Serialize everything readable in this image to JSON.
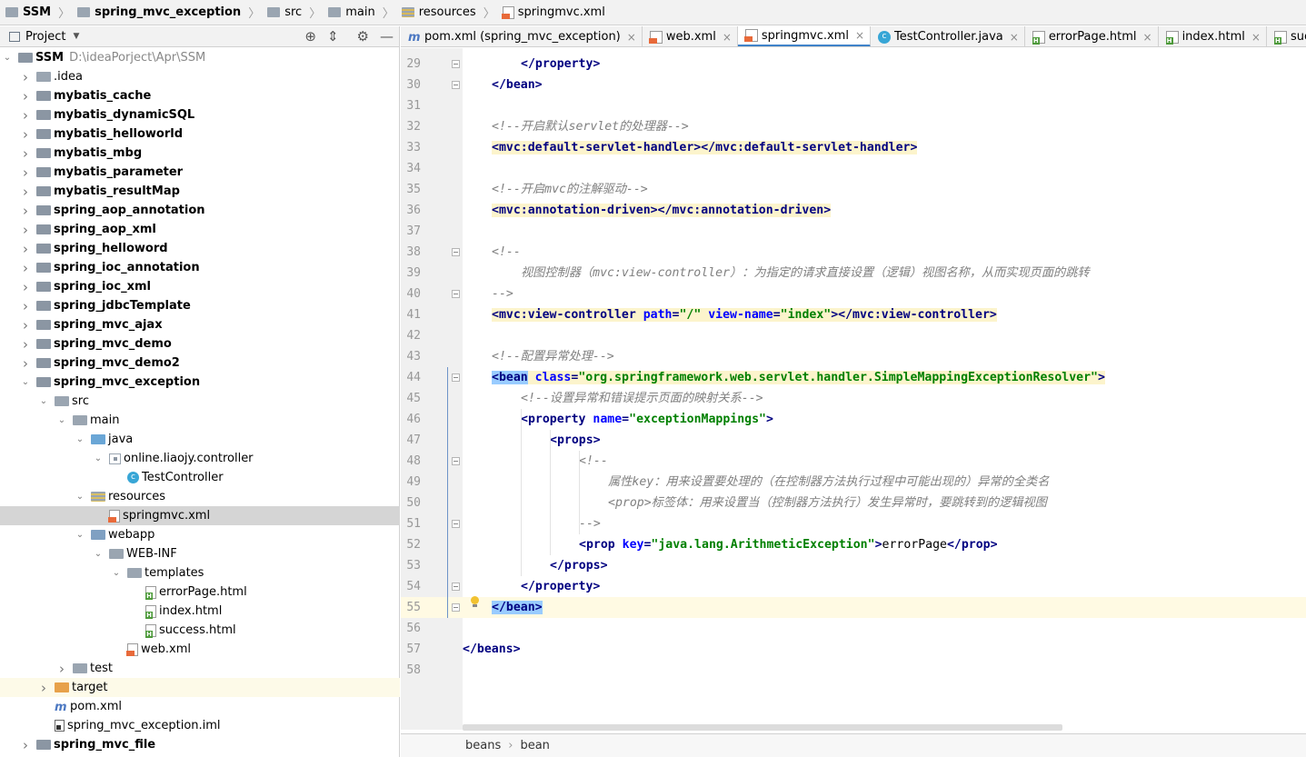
{
  "breadcrumb": [
    "SSM",
    "spring_mvc_exception",
    "src",
    "main",
    "resources",
    "springmvc.xml"
  ],
  "project_panel": {
    "title": "Project",
    "tools": [
      "target-icon",
      "collapse-icon",
      "gear-icon",
      "minimize-icon"
    ]
  },
  "tree": [
    {
      "label": "SSM",
      "extra": "D:\\ideaPorject\\Apr\\SSM",
      "depth": 0,
      "arrow": "down",
      "icon": "module",
      "bold": true
    },
    {
      "label": ".idea",
      "depth": 1,
      "arrow": "right",
      "icon": "folder"
    },
    {
      "label": "mybatis_cache",
      "depth": 1,
      "arrow": "right",
      "icon": "module",
      "bold": true
    },
    {
      "label": "mybatis_dynamicSQL",
      "depth": 1,
      "arrow": "right",
      "icon": "module",
      "bold": true
    },
    {
      "label": "mybatis_helloworld",
      "depth": 1,
      "arrow": "right",
      "icon": "module",
      "bold": true
    },
    {
      "label": "mybatis_mbg",
      "depth": 1,
      "arrow": "right",
      "icon": "module",
      "bold": true
    },
    {
      "label": "mybatis_parameter",
      "depth": 1,
      "arrow": "right",
      "icon": "module",
      "bold": true
    },
    {
      "label": "mybatis_resultMap",
      "depth": 1,
      "arrow": "right",
      "icon": "module",
      "bold": true
    },
    {
      "label": "spring_aop_annotation",
      "depth": 1,
      "arrow": "right",
      "icon": "module",
      "bold": true
    },
    {
      "label": "spring_aop_xml",
      "depth": 1,
      "arrow": "right",
      "icon": "module",
      "bold": true
    },
    {
      "label": "spring_helloword",
      "depth": 1,
      "arrow": "right",
      "icon": "module",
      "bold": true
    },
    {
      "label": "spring_ioc_annotation",
      "depth": 1,
      "arrow": "right",
      "icon": "module",
      "bold": true
    },
    {
      "label": "spring_ioc_xml",
      "depth": 1,
      "arrow": "right",
      "icon": "module",
      "bold": true
    },
    {
      "label": "spring_jdbcTemplate",
      "depth": 1,
      "arrow": "right",
      "icon": "module",
      "bold": true
    },
    {
      "label": "spring_mvc_ajax",
      "depth": 1,
      "arrow": "right",
      "icon": "module",
      "bold": true
    },
    {
      "label": "spring_mvc_demo",
      "depth": 1,
      "arrow": "right",
      "icon": "module",
      "bold": true
    },
    {
      "label": "spring_mvc_demo2",
      "depth": 1,
      "arrow": "right",
      "icon": "module",
      "bold": true
    },
    {
      "label": "spring_mvc_exception",
      "depth": 1,
      "arrow": "down",
      "icon": "module",
      "bold": true
    },
    {
      "label": "src",
      "depth": 2,
      "arrow": "down",
      "icon": "src"
    },
    {
      "label": "main",
      "depth": 3,
      "arrow": "down",
      "icon": "src"
    },
    {
      "label": "java",
      "depth": 4,
      "arrow": "down",
      "icon": "java"
    },
    {
      "label": "online.liaojy.controller",
      "depth": 5,
      "arrow": "down",
      "icon": "package"
    },
    {
      "label": "TestController",
      "depth": 6,
      "arrow": "",
      "icon": "class"
    },
    {
      "label": "resources",
      "depth": 4,
      "arrow": "down",
      "icon": "res"
    },
    {
      "label": "springmvc.xml",
      "depth": 5,
      "arrow": "",
      "icon": "xml",
      "selected": true
    },
    {
      "label": "webapp",
      "depth": 4,
      "arrow": "down",
      "icon": "web"
    },
    {
      "label": "WEB-INF",
      "depth": 5,
      "arrow": "down",
      "icon": "folder"
    },
    {
      "label": "templates",
      "depth": 6,
      "arrow": "down",
      "icon": "folder"
    },
    {
      "label": "errorPage.html",
      "depth": 7,
      "arrow": "",
      "icon": "html"
    },
    {
      "label": "index.html",
      "depth": 7,
      "arrow": "",
      "icon": "html"
    },
    {
      "label": "success.html",
      "depth": 7,
      "arrow": "",
      "icon": "html"
    },
    {
      "label": "web.xml",
      "depth": 6,
      "arrow": "",
      "icon": "xml"
    },
    {
      "label": "test",
      "depth": 3,
      "arrow": "right",
      "icon": "folder"
    },
    {
      "label": "target",
      "depth": 2,
      "arrow": "right",
      "icon": "orange",
      "highlight": true
    },
    {
      "label": "pom.xml",
      "depth": 2,
      "arrow": "",
      "icon": "maven"
    },
    {
      "label": "spring_mvc_exception.iml",
      "depth": 2,
      "arrow": "",
      "icon": "iml"
    },
    {
      "label": "spring_mvc_file",
      "depth": 1,
      "arrow": "right",
      "icon": "module",
      "bold": true
    }
  ],
  "tabs": [
    {
      "label": "pom.xml (spring_mvc_exception)",
      "icon": "maven",
      "active": false
    },
    {
      "label": "web.xml",
      "icon": "xml",
      "active": false
    },
    {
      "label": "springmvc.xml",
      "icon": "xml",
      "active": true
    },
    {
      "label": "TestController.java",
      "icon": "class",
      "active": false
    },
    {
      "label": "errorPage.html",
      "icon": "html",
      "active": false
    },
    {
      "label": "index.html",
      "icon": "html",
      "active": false
    },
    {
      "label": "success.html",
      "icon": "html",
      "active": false
    }
  ],
  "code_lines": [
    {
      "n": "29",
      "indent": 2,
      "parts": [
        [
          "tag",
          "</property>"
        ]
      ]
    },
    {
      "n": "30",
      "indent": 1,
      "parts": [
        [
          "tag",
          "</bean>"
        ]
      ]
    },
    {
      "n": "31",
      "indent": 0,
      "parts": []
    },
    {
      "n": "32",
      "indent": 1,
      "parts": [
        [
          "cmt",
          "<!--开启默认servlet的处理器-->"
        ]
      ]
    },
    {
      "n": "33",
      "indent": 1,
      "bg": true,
      "parts": [
        [
          "tag",
          "<mvc:default-servlet-handler></mvc:default-servlet-handler>"
        ]
      ]
    },
    {
      "n": "34",
      "indent": 0,
      "parts": []
    },
    {
      "n": "35",
      "indent": 1,
      "parts": [
        [
          "cmt",
          "<!--开启mvc的注解驱动-->"
        ]
      ]
    },
    {
      "n": "36",
      "indent": 1,
      "bg": true,
      "parts": [
        [
          "tag",
          "<mvc:annotation-driven></mvc:annotation-driven>"
        ]
      ]
    },
    {
      "n": "37",
      "indent": 0,
      "parts": []
    },
    {
      "n": "38",
      "indent": 1,
      "parts": [
        [
          "cmt",
          "<!--"
        ]
      ]
    },
    {
      "n": "39",
      "indent": 2,
      "parts": [
        [
          "cmt",
          "视图控制器（mvc:view-controller）：为指定的请求直接设置（逻辑）视图名称，从而实现页面的跳转"
        ]
      ]
    },
    {
      "n": "40",
      "indent": 1,
      "parts": [
        [
          "cmt",
          "-->"
        ]
      ]
    },
    {
      "n": "41",
      "indent": 1,
      "bg": true,
      "parts": [
        [
          "tag",
          "<mvc:view-controller "
        ],
        [
          "attr",
          "path"
        ],
        [
          "tag",
          "="
        ],
        [
          "val",
          "\"/\""
        ],
        [
          "tag",
          " "
        ],
        [
          "attr",
          "view-name"
        ],
        [
          "tag",
          "="
        ],
        [
          "val",
          "\"index\""
        ],
        [
          "tag",
          "></mvc:view-controller>"
        ]
      ]
    },
    {
      "n": "42",
      "indent": 0,
      "parts": []
    },
    {
      "n": "43",
      "indent": 1,
      "parts": [
        [
          "cmt",
          "<!--配置异常处理-->"
        ]
      ]
    },
    {
      "n": "44",
      "indent": 1,
      "bg": true,
      "parts": [
        [
          "match",
          "<bean"
        ],
        [
          "tag",
          " "
        ],
        [
          "attr",
          "class"
        ],
        [
          "tag",
          "="
        ],
        [
          "val",
          "\"org.springframework.web.servlet.handler.SimpleMappingExceptionResolver\""
        ],
        [
          "tag",
          ">"
        ]
      ]
    },
    {
      "n": "45",
      "indent": 2,
      "parts": [
        [
          "cmt",
          "<!--设置异常和错误提示页面的映射关系-->"
        ]
      ]
    },
    {
      "n": "46",
      "indent": 2,
      "parts": [
        [
          "tag",
          "<property "
        ],
        [
          "attr",
          "name"
        ],
        [
          "tag",
          "="
        ],
        [
          "val",
          "\"exceptionMappings\""
        ],
        [
          "tag",
          ">"
        ]
      ]
    },
    {
      "n": "47",
      "indent": 3,
      "parts": [
        [
          "tag",
          "<props>"
        ]
      ]
    },
    {
      "n": "48",
      "indent": 4,
      "parts": [
        [
          "cmt",
          "<!--"
        ]
      ]
    },
    {
      "n": "49",
      "indent": 5,
      "parts": [
        [
          "cmt",
          "属性key：用来设置要处理的（在控制器方法执行过程中可能出现的）异常的全类名"
        ]
      ]
    },
    {
      "n": "50",
      "indent": 5,
      "parts": [
        [
          "cmt",
          "<prop>标签体：用来设置当（控制器方法执行）发生异常时，要跳转到的逻辑视图"
        ]
      ]
    },
    {
      "n": "51",
      "indent": 4,
      "parts": [
        [
          "cmt",
          "-->"
        ]
      ]
    },
    {
      "n": "52",
      "indent": 4,
      "parts": [
        [
          "tag",
          "<prop "
        ],
        [
          "attr",
          "key"
        ],
        [
          "tag",
          "="
        ],
        [
          "val",
          "\"java.lang.ArithmeticException\""
        ],
        [
          "tag",
          ">"
        ],
        [
          "plain",
          "errorPage"
        ],
        [
          "tag",
          "</prop>"
        ]
      ]
    },
    {
      "n": "53",
      "indent": 3,
      "parts": [
        [
          "tag",
          "</props>"
        ]
      ]
    },
    {
      "n": "54",
      "indent": 2,
      "parts": [
        [
          "tag",
          "</property>"
        ]
      ]
    },
    {
      "n": "55",
      "indent": 1,
      "current": true,
      "parts": [
        [
          "match",
          "</bean>"
        ]
      ]
    },
    {
      "n": "56",
      "indent": 0,
      "parts": []
    },
    {
      "n": "57",
      "indent": 0,
      "parts": [
        [
          "tag",
          "</beans>"
        ]
      ]
    },
    {
      "n": "58",
      "indent": 0,
      "parts": []
    }
  ],
  "status_path": [
    "beans",
    "bean"
  ]
}
